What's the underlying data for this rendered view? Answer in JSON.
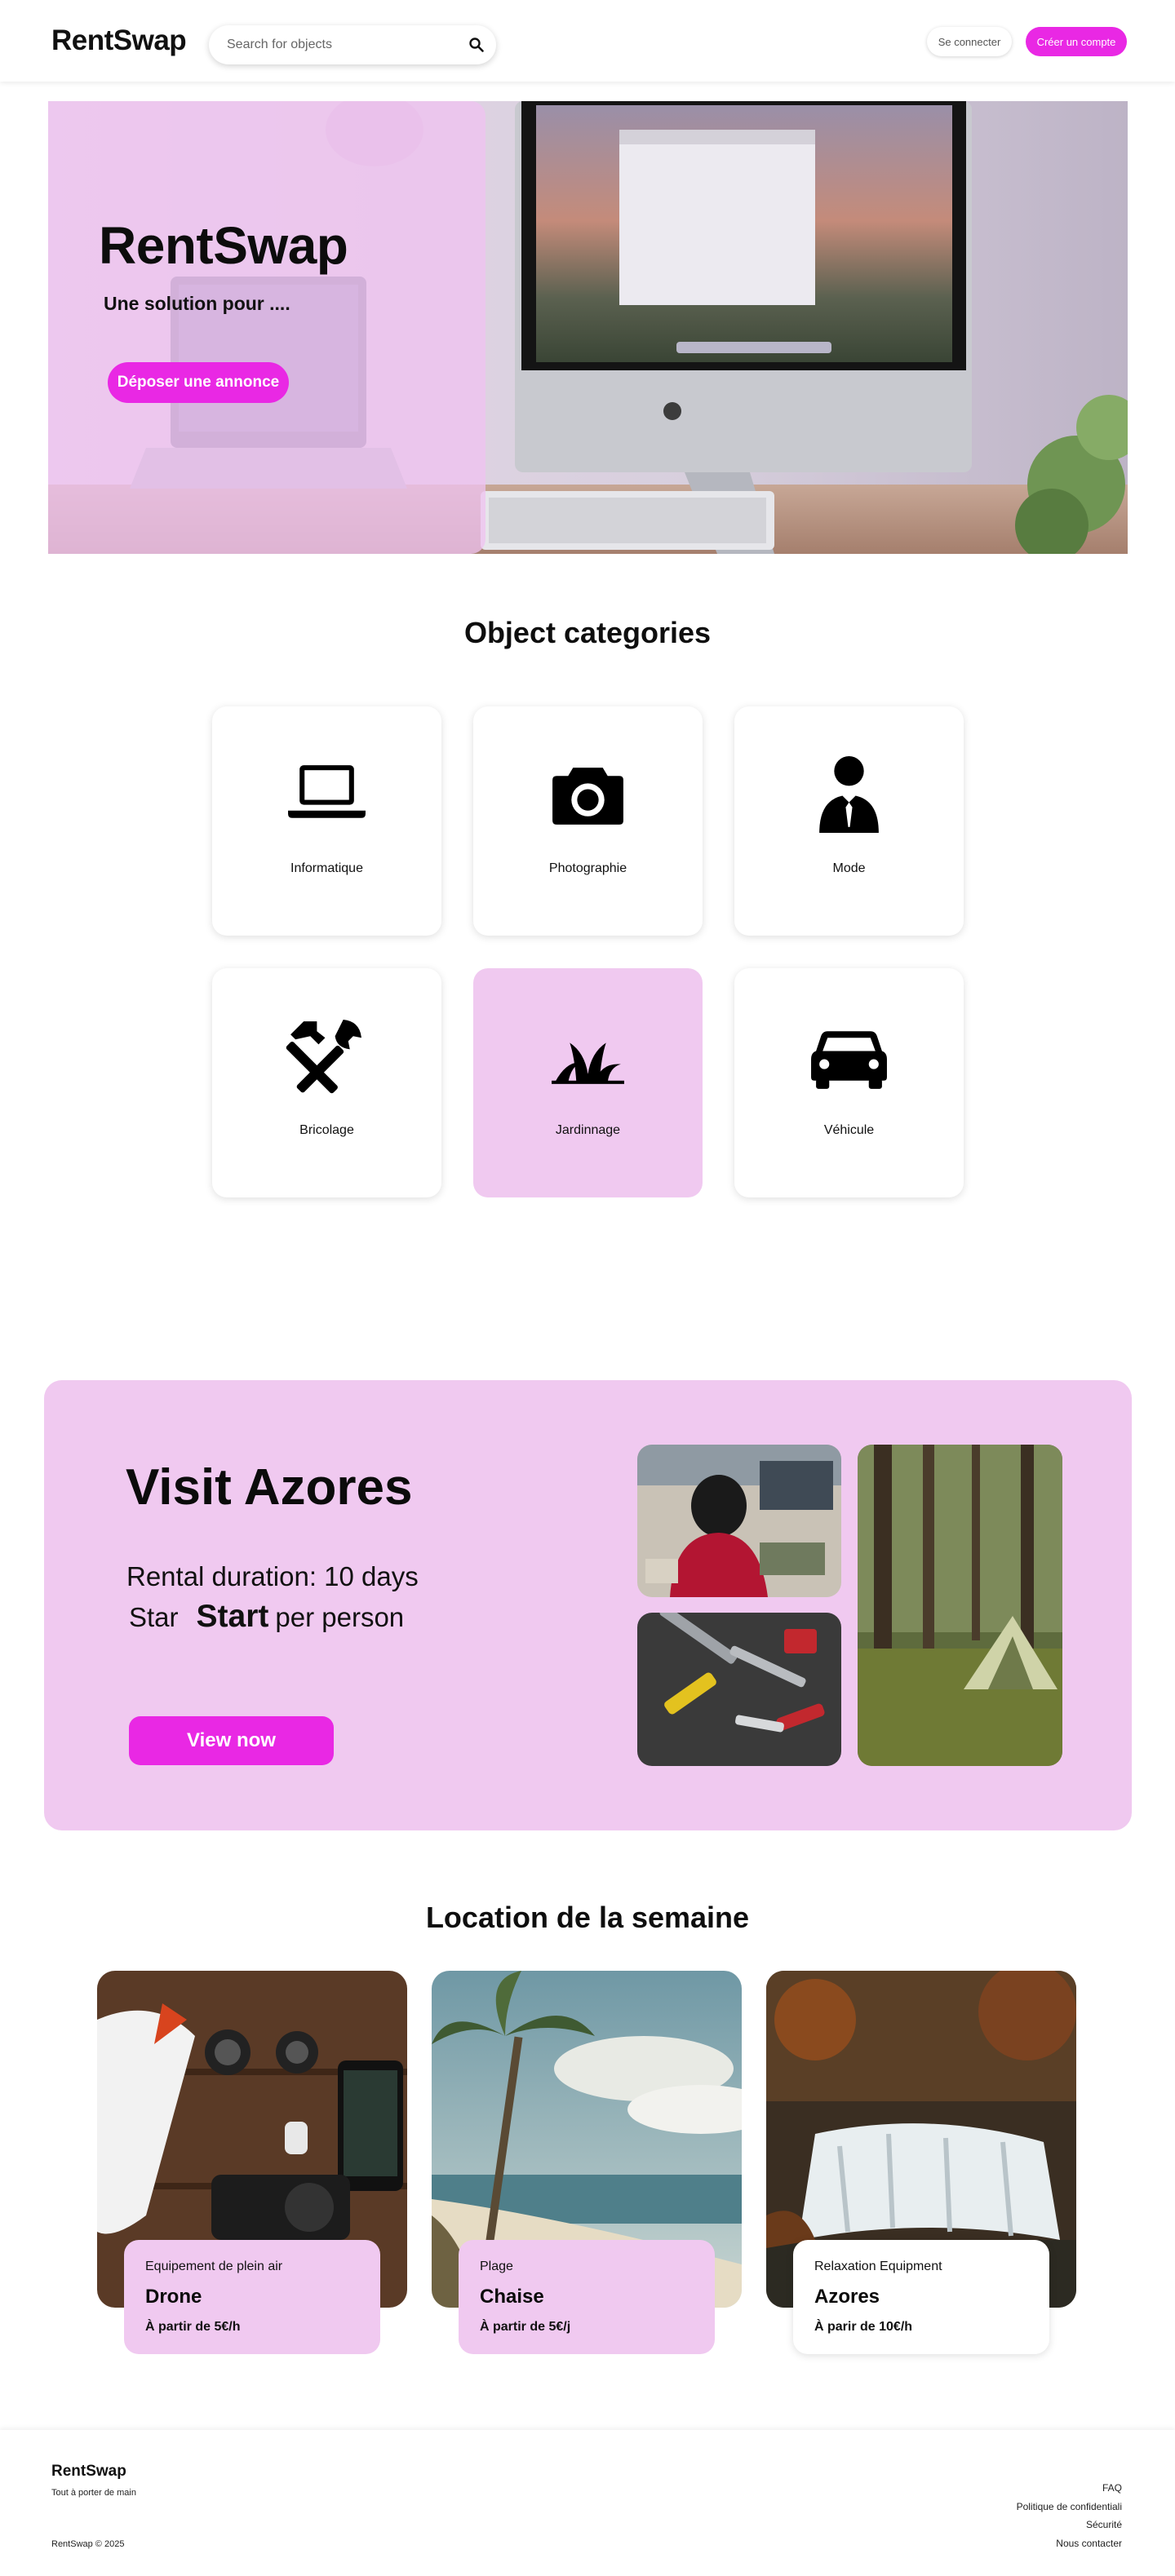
{
  "header": {
    "logo": "RentSwap",
    "search_placeholder": "Search for objects",
    "login_label": "Se connecter",
    "signup_label": "Créer un compte"
  },
  "hero": {
    "title": "RentSwap",
    "subtitle": "Une solution pour ....",
    "cta_label": "Déposer une annonce"
  },
  "categories": {
    "title": "Object categories",
    "items": [
      {
        "label": "Informatique",
        "icon": "laptop-icon"
      },
      {
        "label": "Photographie",
        "icon": "camera-icon"
      },
      {
        "label": "Mode",
        "icon": "person-tie-icon"
      },
      {
        "label": "Bricolage",
        "icon": "tools-icon"
      },
      {
        "label": "Jardinnage",
        "icon": "grass-icon"
      },
      {
        "label": "Véhicule",
        "icon": "car-icon"
      }
    ]
  },
  "promo": {
    "title": "Visit Azores",
    "duration": "Rental duration: 10 days",
    "start_prefix": "Star",
    "start_word": "Start",
    "start_suffix": "per person",
    "cta_label": "View now"
  },
  "weekly": {
    "title": "Location de la semaine",
    "items": [
      {
        "category": "Equipement de plein air",
        "name": "Drone",
        "price": "À partir de 5€/h"
      },
      {
        "category": "Plage",
        "name": "Chaise",
        "price": "À partir de 5€/j"
      },
      {
        "category": "Relaxation Equipment",
        "name": "Azores",
        "price": "À parir de 10€/h"
      }
    ]
  },
  "footer": {
    "brand": "RentSwap",
    "tagline": "Tout à porter de main",
    "copyright": "RentSwap © 2025",
    "links": [
      "FAQ",
      "Politique de confidentiali",
      "Sécurité",
      "Nous contacter"
    ]
  },
  "colors": {
    "accent": "#e928e4",
    "pink_light": "#f0c9f0"
  }
}
